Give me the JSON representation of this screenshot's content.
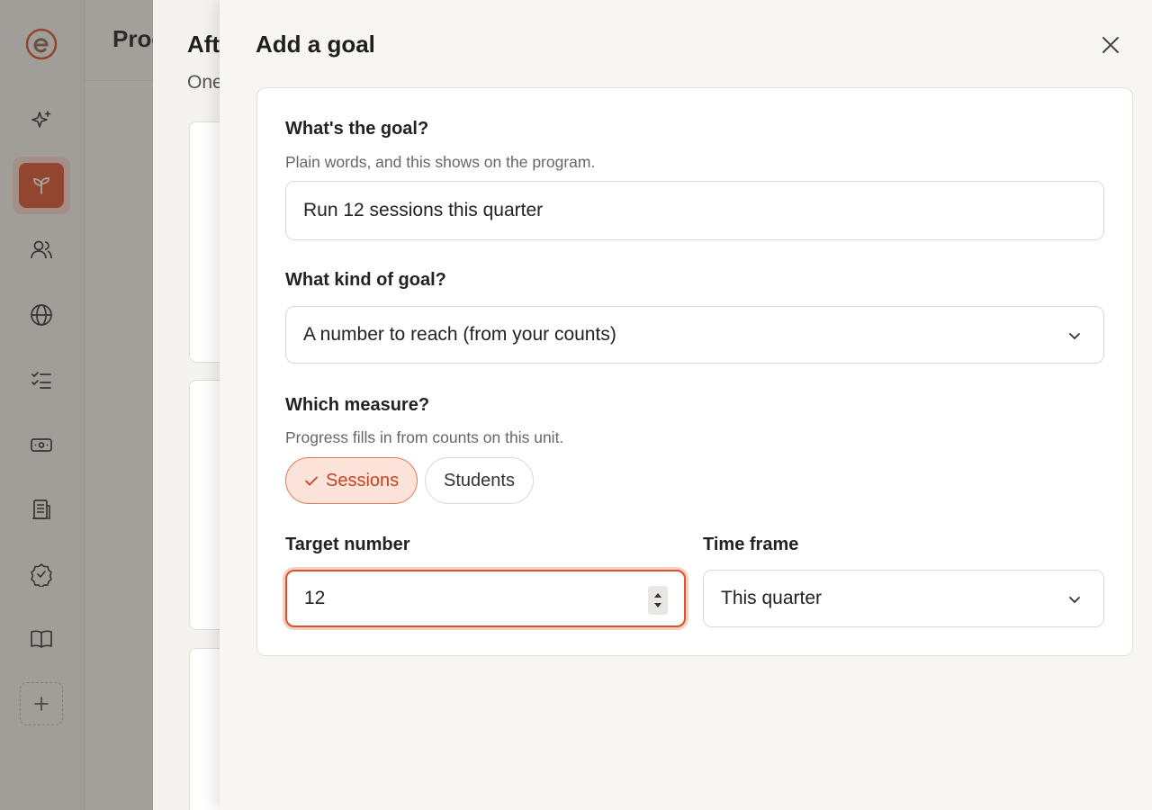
{
  "app": {
    "background_title": "Prog",
    "accent": "#d9532e"
  },
  "back_panel": {
    "title": "Aft",
    "subtitle": "One"
  },
  "drawer": {
    "title": "Add a goal",
    "goal": {
      "label": "What's the goal?",
      "help": "Plain words, and this shows on the program.",
      "value": "Run 12 sessions this quarter"
    },
    "kind": {
      "label": "What kind of goal?",
      "selected": "A number to reach (from your counts)"
    },
    "measure": {
      "label": "Which measure?",
      "help": "Progress fills in from counts on this unit.",
      "options": [
        {
          "label": "Sessions",
          "selected": true
        },
        {
          "label": "Students",
          "selected": false
        }
      ]
    },
    "target": {
      "label": "Target number",
      "value": "12"
    },
    "timeframe": {
      "label": "Time frame",
      "selected": "This quarter"
    }
  }
}
